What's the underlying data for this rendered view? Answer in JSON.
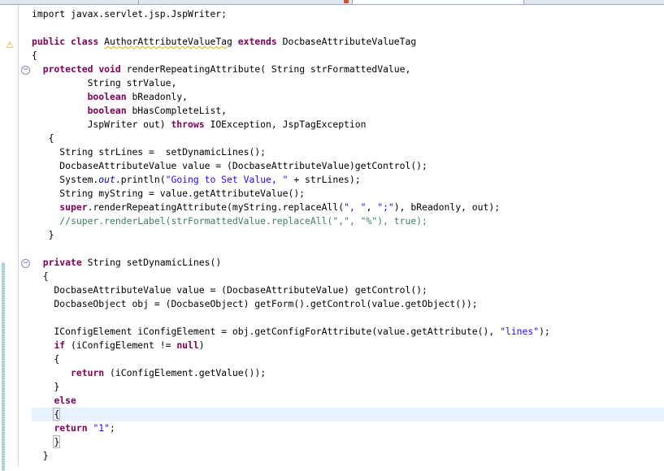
{
  "editor": {
    "lines": [
      [
        {
          "t": "import javax.servlet.jsp.JspWriter;"
        }
      ],
      [],
      [
        {
          "t": "public",
          "c": "kw"
        },
        {
          "t": " "
        },
        {
          "t": "class",
          "c": "kw"
        },
        {
          "t": " "
        },
        {
          "t": "AuthorAttributeValueTag",
          "c": "sq"
        },
        {
          "t": " "
        },
        {
          "t": "extends",
          "c": "kw"
        },
        {
          "t": " DocbaseAttributeValueTag"
        }
      ],
      [
        {
          "t": "{"
        }
      ],
      [
        {
          "t": "  "
        },
        {
          "t": "protected",
          "c": "kw"
        },
        {
          "t": " "
        },
        {
          "t": "void",
          "c": "kw"
        },
        {
          "t": " renderRepeatingAttribute( String strFormattedValue,"
        }
      ],
      [
        {
          "t": "          String strValue,"
        }
      ],
      [
        {
          "t": "          "
        },
        {
          "t": "boolean",
          "c": "kw"
        },
        {
          "t": " bReadonly,"
        }
      ],
      [
        {
          "t": "          "
        },
        {
          "t": "boolean",
          "c": "kw"
        },
        {
          "t": " bHasCompleteList,"
        }
      ],
      [
        {
          "t": "          JspWriter out) "
        },
        {
          "t": "throws",
          "c": "kw"
        },
        {
          "t": " IOException, JspTagException"
        }
      ],
      [
        {
          "t": "   {"
        }
      ],
      [
        {
          "t": "     String strLines =  setDynamicLines();"
        }
      ],
      [
        {
          "t": "     DocbaseAttributeValue value = (DocbaseAttributeValue)getControl();"
        }
      ],
      [
        {
          "t": "     System."
        },
        {
          "t": "out",
          "c": "fd"
        },
        {
          "t": ".println("
        },
        {
          "t": "\"Going to Set Value, \"",
          "c": "st"
        },
        {
          "t": " + strLines);"
        }
      ],
      [
        {
          "t": "     String myString = value.getAttributeValue();"
        }
      ],
      [
        {
          "t": "     "
        },
        {
          "t": "super",
          "c": "kw"
        },
        {
          "t": ".renderRepeatingAttribute(myString.replaceAll("
        },
        {
          "t": "\", \"",
          "c": "st"
        },
        {
          "t": ", "
        },
        {
          "t": "\";\"",
          "c": "st"
        },
        {
          "t": "), bReadonly, out);"
        }
      ],
      [
        {
          "t": "     //super.renderLabel(strFormattedValue.replaceAll(\",\", \"%\"), true);",
          "c": "cm"
        }
      ],
      [
        {
          "t": "   }"
        }
      ],
      [],
      [
        {
          "t": "  "
        },
        {
          "t": "private",
          "c": "kw"
        },
        {
          "t": " String setDynamicLines()"
        }
      ],
      [
        {
          "t": "  {"
        }
      ],
      [
        {
          "t": "    DocbaseAttributeValue value = (DocbaseAttributeValue) getControl();"
        }
      ],
      [
        {
          "t": "    DocbaseObject obj = (DocbaseObject) getForm().getControl(value.getObject());"
        }
      ],
      [],
      [
        {
          "t": "    IConfigElement iConfigElement = obj.getConfigForAttribute(value.getAttribute(), "
        },
        {
          "t": "\"lines\"",
          "c": "st"
        },
        {
          "t": ");"
        }
      ],
      [
        {
          "t": "    "
        },
        {
          "t": "if",
          "c": "kw"
        },
        {
          "t": " (iConfigElement != "
        },
        {
          "t": "null",
          "c": "kw"
        },
        {
          "t": ")"
        }
      ],
      [
        {
          "t": "    {"
        }
      ],
      [
        {
          "t": "       "
        },
        {
          "t": "return",
          "c": "kw"
        },
        {
          "t": " (iConfigElement.getValue());"
        }
      ],
      [
        {
          "t": "    }"
        }
      ],
      [
        {
          "t": "    "
        },
        {
          "t": "else",
          "c": "kw"
        }
      ],
      [
        {
          "t": "    "
        },
        {
          "t": "{",
          "c": "brk"
        },
        {
          "caret": true
        }
      ],
      [
        {
          "t": "    "
        },
        {
          "t": "return",
          "c": "kw"
        },
        {
          "t": " "
        },
        {
          "t": "\"1\"",
          "c": "st"
        },
        {
          "t": ";"
        }
      ],
      [
        {
          "t": "    "
        },
        {
          "t": "}",
          "c": "brk"
        }
      ],
      [
        {
          "t": "  }"
        }
      ]
    ]
  },
  "gutter": {
    "warning_icon": "warning-bulb-icon",
    "fold_icon": "collapse-fold-icon"
  },
  "colors": {
    "keyword": "#7f0055",
    "string": "#2a00ff",
    "comment": "#3f7f5f",
    "field": "#0000c0",
    "current_line": "#e8f2fe"
  }
}
